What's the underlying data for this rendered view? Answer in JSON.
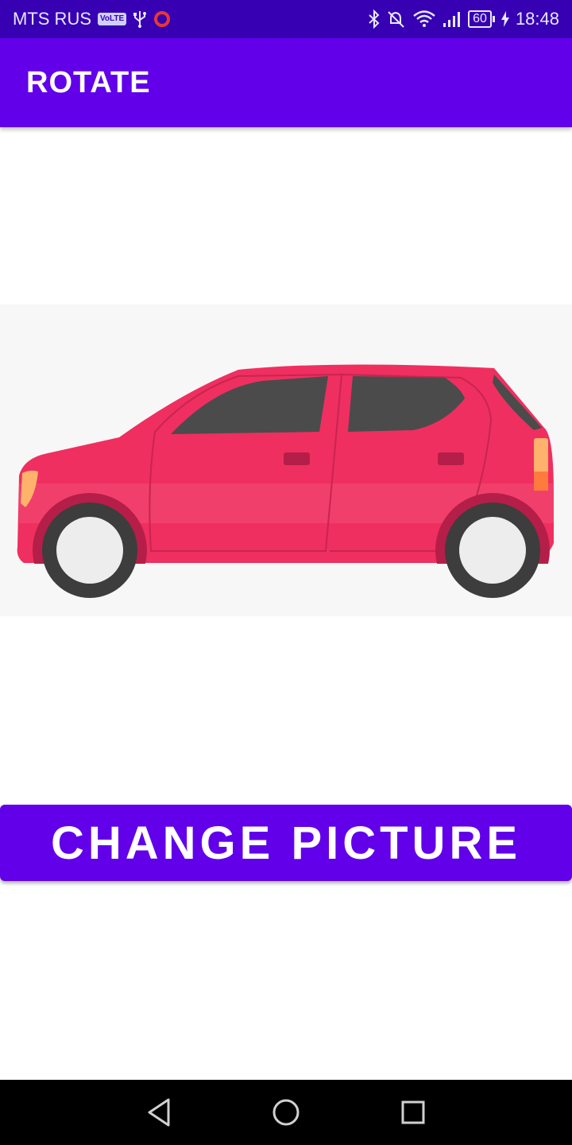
{
  "status_bar": {
    "carrier": "MTS RUS",
    "volte_badge": "VoLTE",
    "battery_level": "60",
    "time": "18:48",
    "icons": [
      "volte-icon",
      "usb-icon",
      "record-icon",
      "bluetooth-icon",
      "mute-icon",
      "wifi-icon",
      "signal-icon",
      "battery-icon",
      "charging-icon"
    ]
  },
  "app_bar": {
    "title": "ROTATE"
  },
  "main": {
    "image_name": "red-car-image",
    "button_label": "CHANGE PICTURE"
  },
  "colors": {
    "status_bar": "#3700b3",
    "primary": "#6200ea",
    "car_body": "#ef2f60",
    "car_window": "#4b4b4b",
    "wheel": "#3d3d3d",
    "nav_bar": "#000000"
  },
  "nav_bar": {
    "buttons": [
      "back-icon",
      "home-icon",
      "recents-icon"
    ]
  }
}
